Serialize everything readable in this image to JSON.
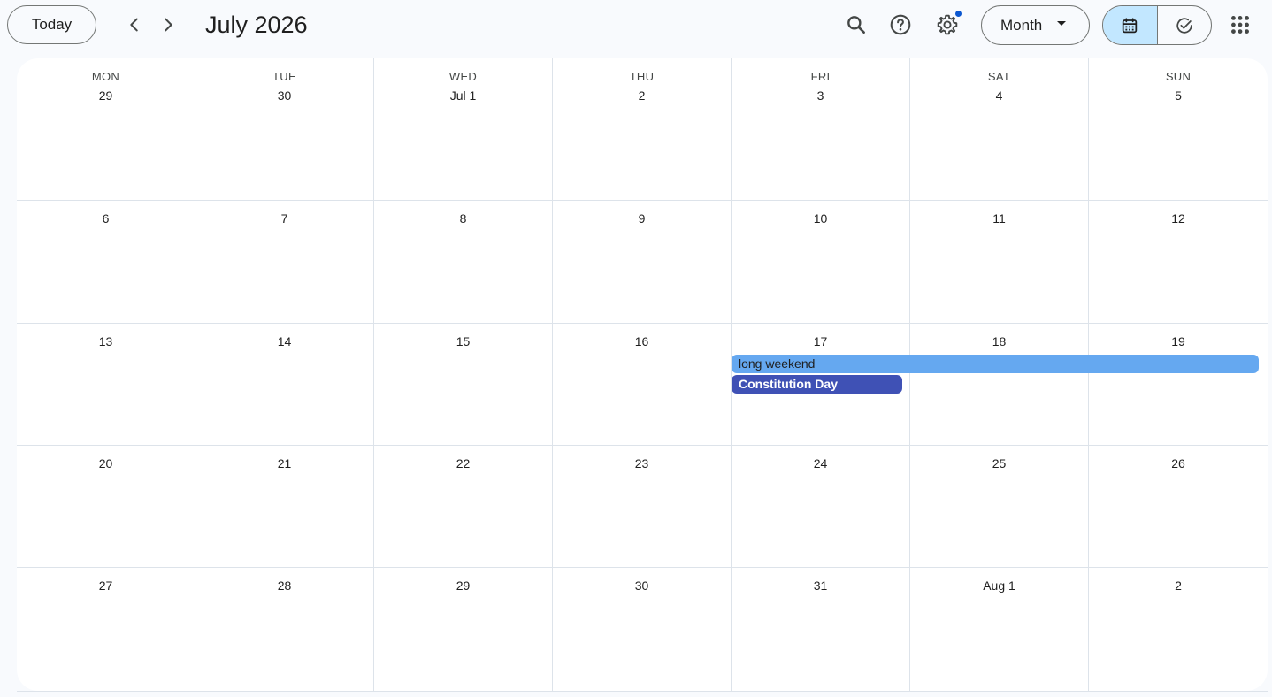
{
  "header": {
    "today_label": "Today",
    "month_title": "July 2026",
    "view_selected": "Month",
    "icons": {
      "prev": "chevron-left-icon",
      "next": "chevron-right-icon",
      "search": "search-icon",
      "help": "help-icon",
      "settings": "gear-icon",
      "calendar_view": "calendar-icon",
      "tasks_view": "task-check-icon",
      "apps": "apps-grid-icon"
    },
    "colors": {
      "selected_segment": "#c2e7ff",
      "notification_dot": "#0b57d0"
    }
  },
  "weekdays": [
    "MON",
    "TUE",
    "WED",
    "THU",
    "FRI",
    "SAT",
    "SUN"
  ],
  "weeks": [
    [
      "29",
      "30",
      "Jul 1",
      "2",
      "3",
      "4",
      "5"
    ],
    [
      "6",
      "7",
      "8",
      "9",
      "10",
      "11",
      "12"
    ],
    [
      "13",
      "14",
      "15",
      "16",
      "17",
      "18",
      "19"
    ],
    [
      "20",
      "21",
      "22",
      "23",
      "24",
      "25",
      "26"
    ],
    [
      "27",
      "28",
      "29",
      "30",
      "31",
      "Aug 1",
      "2"
    ]
  ],
  "events": [
    {
      "title": "long weekend",
      "start": "17",
      "end": "19",
      "color": "#65a8f0"
    },
    {
      "title": "Constitution Day",
      "start": "17",
      "end": "17",
      "color": "#3f51b5"
    }
  ]
}
